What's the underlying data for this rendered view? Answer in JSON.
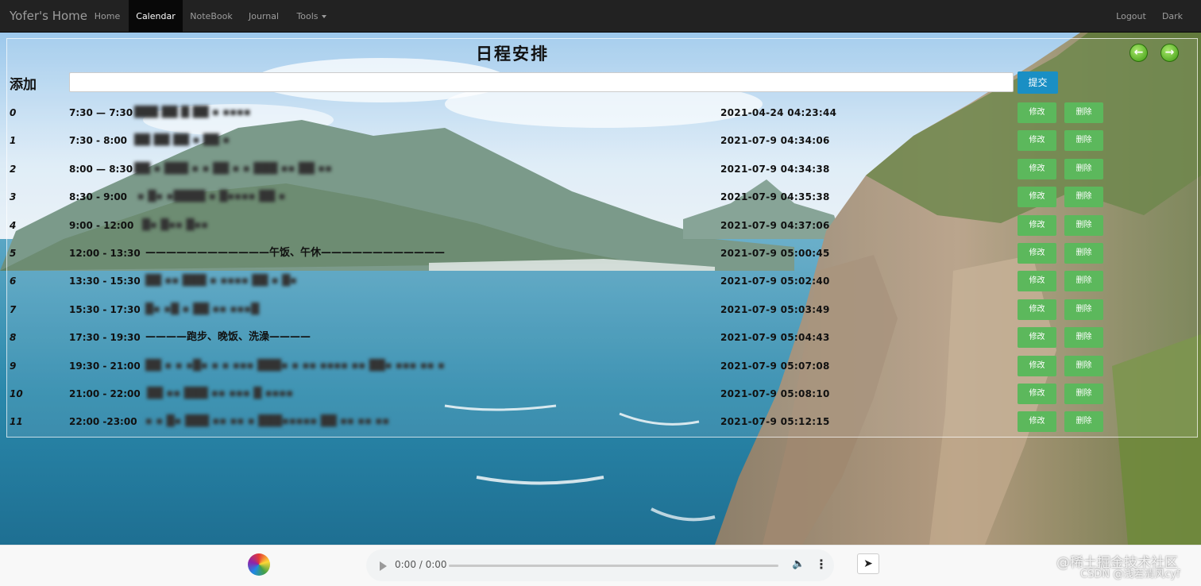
{
  "navbar": {
    "brand": "Yofer's Home",
    "items": [
      {
        "label": "Home"
      },
      {
        "label": "Calendar",
        "active": true
      },
      {
        "label": "NoteBook"
      },
      {
        "label": "Journal"
      },
      {
        "label": "Tools"
      }
    ],
    "right_items": [
      {
        "label": "Logout"
      },
      {
        "label": "Dark"
      }
    ]
  },
  "schedule": {
    "title": "日程安排",
    "add_label": "添加",
    "input_value": "",
    "input_placeholder": "",
    "submit_label": "提交",
    "edit_label": "修改",
    "delete_label": "删除",
    "rows": [
      {
        "index": "0",
        "time": "7:30 — 7:30",
        "desc": "███ ██ █ ██ ▪ ▪▪▪▪",
        "timestamp": "2021-04-24 04:23:44"
      },
      {
        "index": "1",
        "time": "7:30 - 8:00",
        "desc": "██ ██ ██ ▪  ██ ▪",
        "timestamp": "2021-07-9 04:34:06"
      },
      {
        "index": "2",
        "time": "8:00 — 8:30",
        "desc": "██ ▪  ███ ▪ ▪ ██ ▪ ▪ ███ ▪▪ ██ ▪▪",
        "timestamp": "2021-07-9 04:34:38"
      },
      {
        "index": "3",
        "time": "8:30 - 9:00",
        "desc": "▪ █▪ ▪████ ▪ █▪▪▪▪ ██ ▪",
        "timestamp": "2021-07-9 04:35:38"
      },
      {
        "index": "4",
        "time": "9:00 - 12:00",
        "desc": "█▪ █▪▪ █▪▪",
        "timestamp": "2021-07-9 04:37:06"
      },
      {
        "index": "5",
        "time": "12:00 - 13:30",
        "desc": "————————————午饭、午休————————————",
        "timestamp": "2021-07-9 05:00:45"
      },
      {
        "index": "6",
        "time": "13:30 - 15:30",
        "desc": "██ ▪▪ ███ ▪ ▪▪▪▪   ██ ▪ █▪",
        "timestamp": "2021-07-9 05:02:40"
      },
      {
        "index": "7",
        "time": "15:30 - 17:30",
        "desc": "█▪ ▪█ ▪ ██ ▪▪ ▪▪▪█",
        "timestamp": "2021-07-9 05:03:49"
      },
      {
        "index": "8",
        "time": "17:30 - 19:30",
        "desc": "————跑步、晚饭、洗澡————",
        "timestamp": "2021-07-9 05:04:43"
      },
      {
        "index": "9",
        "time": "19:30 - 21:00",
        "desc": "██ ▪ ▪ ▪█▪ ▪ ▪ ▪▪▪ ███▪ ▪ ▪▪ ▪▪▪▪ ▪▪ ██▪ ▪▪▪ ▪▪ ▪",
        "timestamp": "2021-07-9 05:07:08"
      },
      {
        "index": "10",
        "time": "21:00 - 22:00",
        "desc": "██ ▪▪ ███ ▪▪ ▪▪▪ █ ▪▪▪▪",
        "timestamp": "2021-07-9 05:08:10"
      },
      {
        "index": "11",
        "time": "22:00 -23:00",
        "desc": "▪ ▪ █▪   ███ ▪▪ ▪▪ ▪ ███▪▪▪▪▪ ██   ▪▪ ▪▪  ▪▪",
        "timestamp": "2021-07-9 05:12:15"
      }
    ]
  },
  "player": {
    "time": "0:00 / 0:00",
    "progress": 0,
    "send_icon": "send-icon"
  },
  "watermark": {
    "line1": "@稀土掘金技术社区",
    "line2": "CSDN @浅若清风cyf"
  },
  "colors": {
    "navbar": "#222222",
    "action_green": "#5cb85c",
    "submit_blue": "#1a8fc4",
    "sea": "#2d8cb0"
  }
}
